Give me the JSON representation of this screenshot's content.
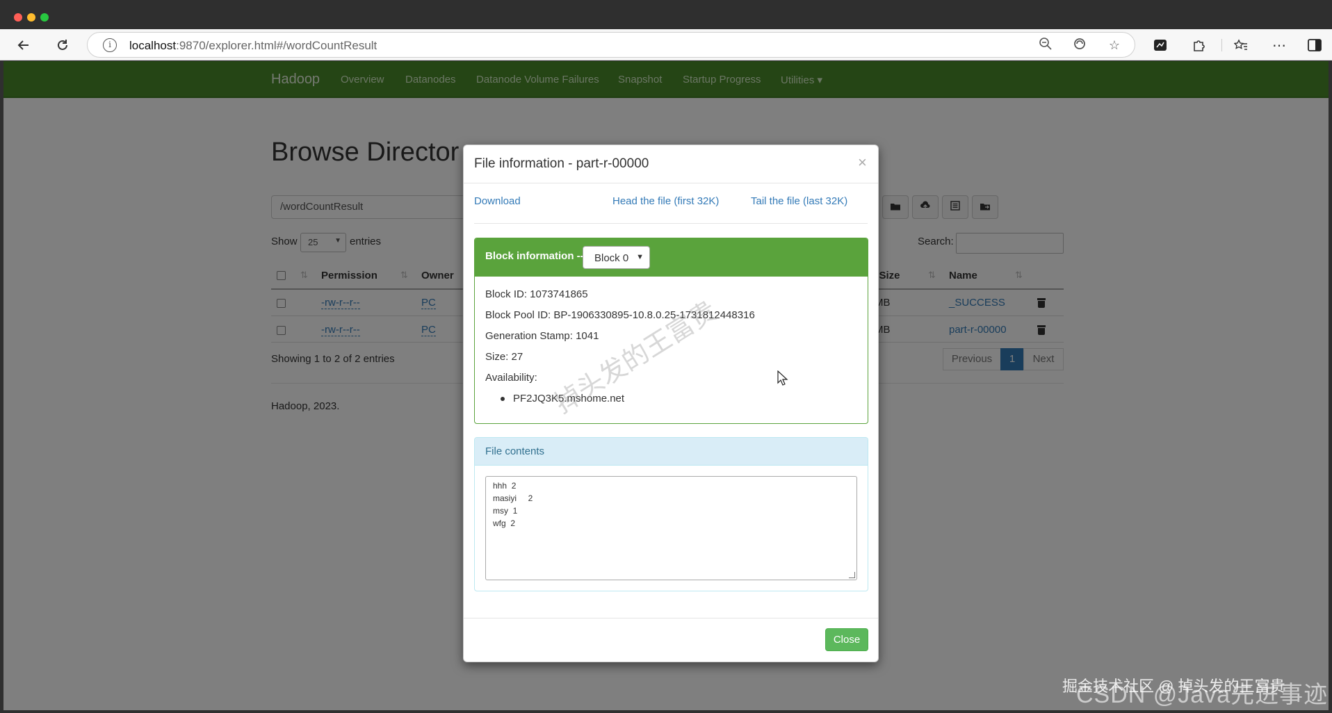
{
  "browser": {
    "url_host": "localhost",
    "url_rest": ":9870/explorer.html#/wordCountResult"
  },
  "navbar": {
    "brand": "Hadoop",
    "links": [
      "Overview",
      "Datanodes",
      "Datanode Volume Failures",
      "Snapshot",
      "Startup Progress",
      "Utilities ▾"
    ]
  },
  "browse": {
    "title": "Browse Director",
    "path": "/wordCountResult",
    "show_label": "Show",
    "entries_label": "entries",
    "page_length": "25",
    "search_label": "Search:",
    "columns": [
      "Permission",
      "Owner",
      "k Size",
      "Name"
    ],
    "rows": [
      {
        "permission": "-rw-r--r--",
        "owner": "PC",
        "block_size": "MB",
        "name": "_SUCCESS"
      },
      {
        "permission": "-rw-r--r--",
        "owner": "PC",
        "block_size": "MB",
        "name": "part-r-00000"
      }
    ],
    "showing": "Showing 1 to 2 of 2 entries",
    "pagination": {
      "previous": "Previous",
      "current": "1",
      "next": "Next"
    },
    "footer": "Hadoop, 2023."
  },
  "modal": {
    "title": "File information - part-r-00000",
    "close_x": "×",
    "download": "Download",
    "head": "Head the file (first 32K)",
    "tail": "Tail the file (last 32K)",
    "block_info_label": "Block information --",
    "block_selected": "Block 0",
    "block_id": "Block ID: 1073741865",
    "block_pool_id": "Block Pool ID: BP-1906330895-10.8.0.25-1731812448316",
    "generation_stamp": "Generation Stamp: 1041",
    "size": "Size: 27",
    "availability": "Availability:",
    "hosts": [
      "PF2JQ3K5.mshome.net"
    ],
    "file_contents_label": "File contents",
    "file_lines": [
      "hhh  2",
      "masiyi     2",
      "msy  1",
      "wfg  2"
    ],
    "close_button": "Close"
  },
  "watermarks": {
    "center": "掉头发的王富贵",
    "bottom_small": "掘金技术社区 @ 掉头发的王富贵",
    "bottom_large": "CSDN @Java先进事迹"
  }
}
